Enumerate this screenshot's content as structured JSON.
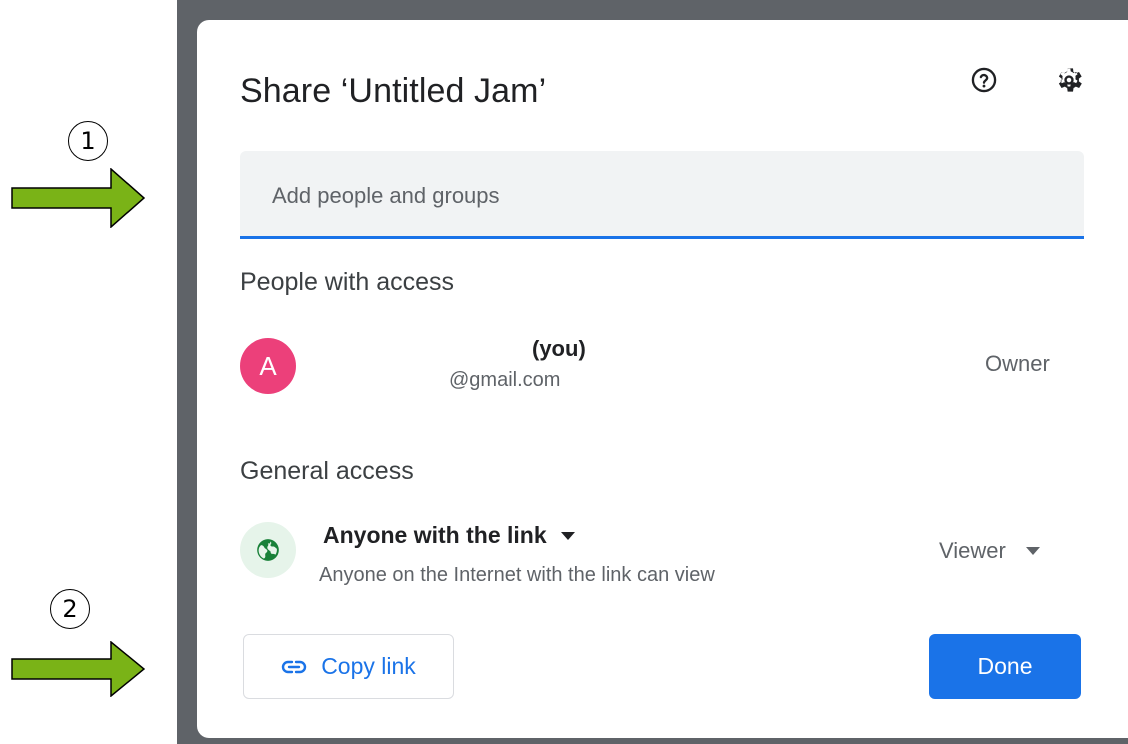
{
  "dialog": {
    "title": "Share ‘Untitled Jam’",
    "help_icon": "help-circle-icon",
    "settings_icon": "gear-icon"
  },
  "search": {
    "placeholder": "Add people and groups",
    "value": ""
  },
  "people_section": {
    "heading": "People with access",
    "people": [
      {
        "avatar_letter": "A",
        "avatar_color": "#ec407a",
        "name": "(you)",
        "email": "@gmail.com",
        "role": "Owner"
      }
    ]
  },
  "general_access": {
    "heading": "General access",
    "access_level": "Anyone with the link",
    "description": "Anyone on the Internet with the link can view",
    "role": "Viewer",
    "icon": "globe-icon"
  },
  "footer": {
    "copy_link_label": "Copy link",
    "done_label": "Done"
  },
  "annotations": [
    {
      "number": "1",
      "arrow": "green-arrow"
    },
    {
      "number": "2",
      "arrow": "green-arrow"
    }
  ],
  "colors": {
    "accent": "#1a73e8",
    "arrow": "#7ab317",
    "backdrop": "#5f6368",
    "globe_bg": "#e6f4ea",
    "globe_fg": "#188038"
  }
}
